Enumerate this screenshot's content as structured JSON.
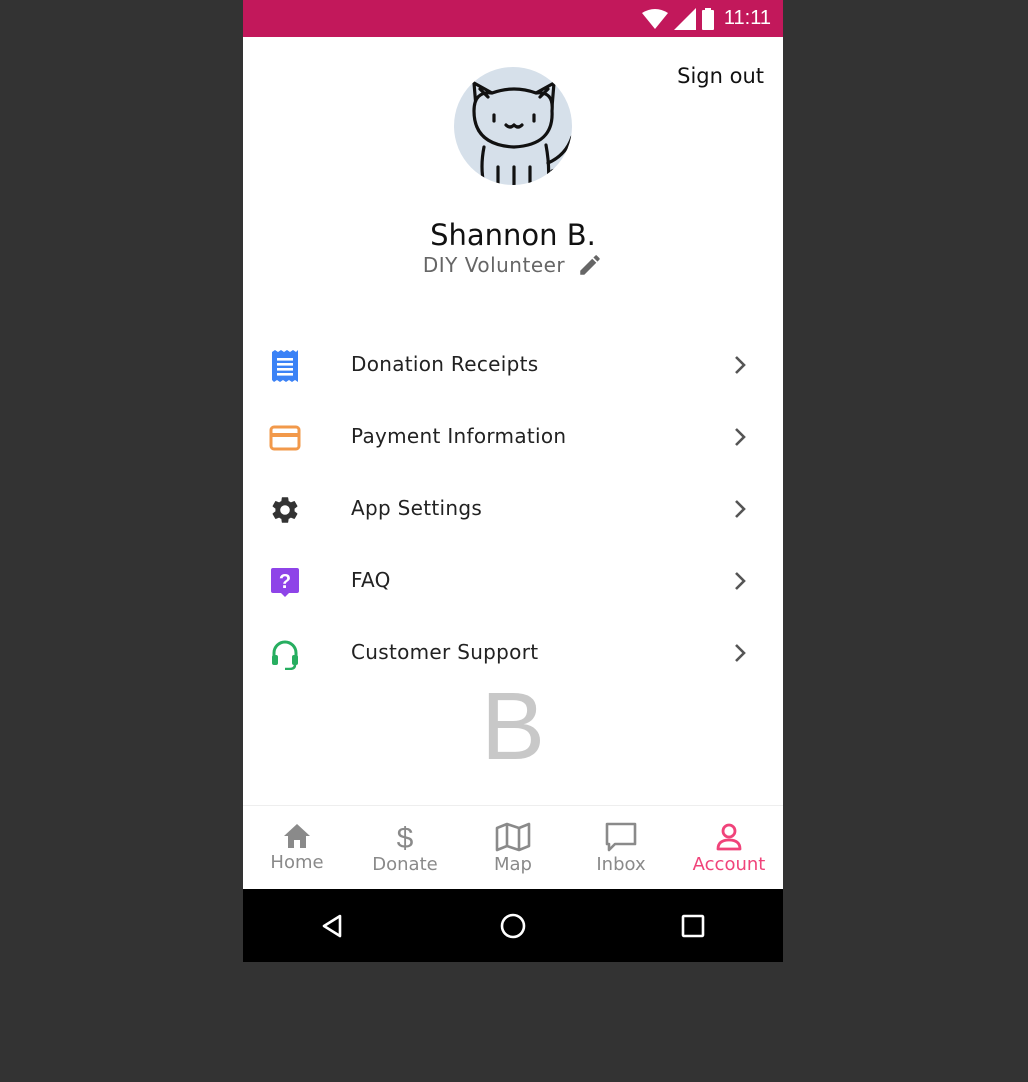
{
  "status": {
    "time": "11:11"
  },
  "header": {
    "sign_out": "Sign out"
  },
  "profile": {
    "name": "Shannon B.",
    "role": "DIY Volunteer"
  },
  "menu": [
    {
      "label": "Donation Receipts",
      "icon": "receipt-icon",
      "color": "#3B82F6"
    },
    {
      "label": "Payment Information",
      "icon": "credit-card-icon",
      "color": "#F2994A"
    },
    {
      "label": "App Settings",
      "icon": "gear-icon",
      "color": "#333333"
    },
    {
      "label": "FAQ",
      "icon": "help-icon",
      "color": "#8E44E8"
    },
    {
      "label": "Customer Support",
      "icon": "headset-icon",
      "color": "#27AE60"
    }
  ],
  "logo_letter": "B",
  "tabs": [
    {
      "label": "Home",
      "icon": "home-icon"
    },
    {
      "label": "Donate",
      "icon": "dollar-icon"
    },
    {
      "label": "Map",
      "icon": "map-icon"
    },
    {
      "label": "Inbox",
      "icon": "inbox-icon"
    },
    {
      "label": "Account",
      "icon": "account-icon",
      "active": true
    }
  ],
  "colors": {
    "status_bar": "#C2185B",
    "accent": "#F0437A",
    "background": "#333333"
  }
}
